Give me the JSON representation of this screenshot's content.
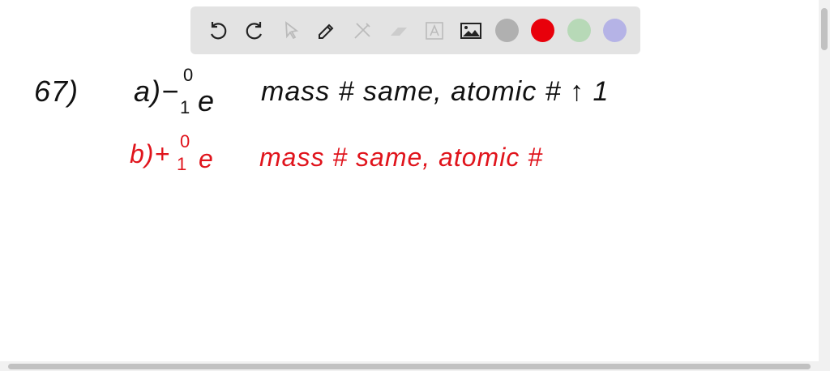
{
  "toolbar": {
    "tools": [
      "undo-icon",
      "redo-icon",
      "select-pointer-icon",
      "pen-icon",
      "tools-icon",
      "eraser-icon",
      "text-box-icon",
      "image-icon"
    ],
    "colors": [
      "#b0b0b0",
      "#e8000b",
      "#b7d9b7",
      "#b5b3e6"
    ]
  },
  "notes": {
    "line1": {
      "number": "67)",
      "label": "a)",
      "symbol": "−",
      "mass": "0",
      "charge": "1",
      "particle": "e",
      "text": "mass # same, atomic # ↑ 1"
    },
    "line2": {
      "label": "b)",
      "symbol": "+",
      "mass": "0",
      "charge": "1",
      "particle": "e",
      "text": "mass # same, atomic #"
    },
    "ink_colors": {
      "black": "#111111",
      "red": "#e0141c"
    }
  }
}
